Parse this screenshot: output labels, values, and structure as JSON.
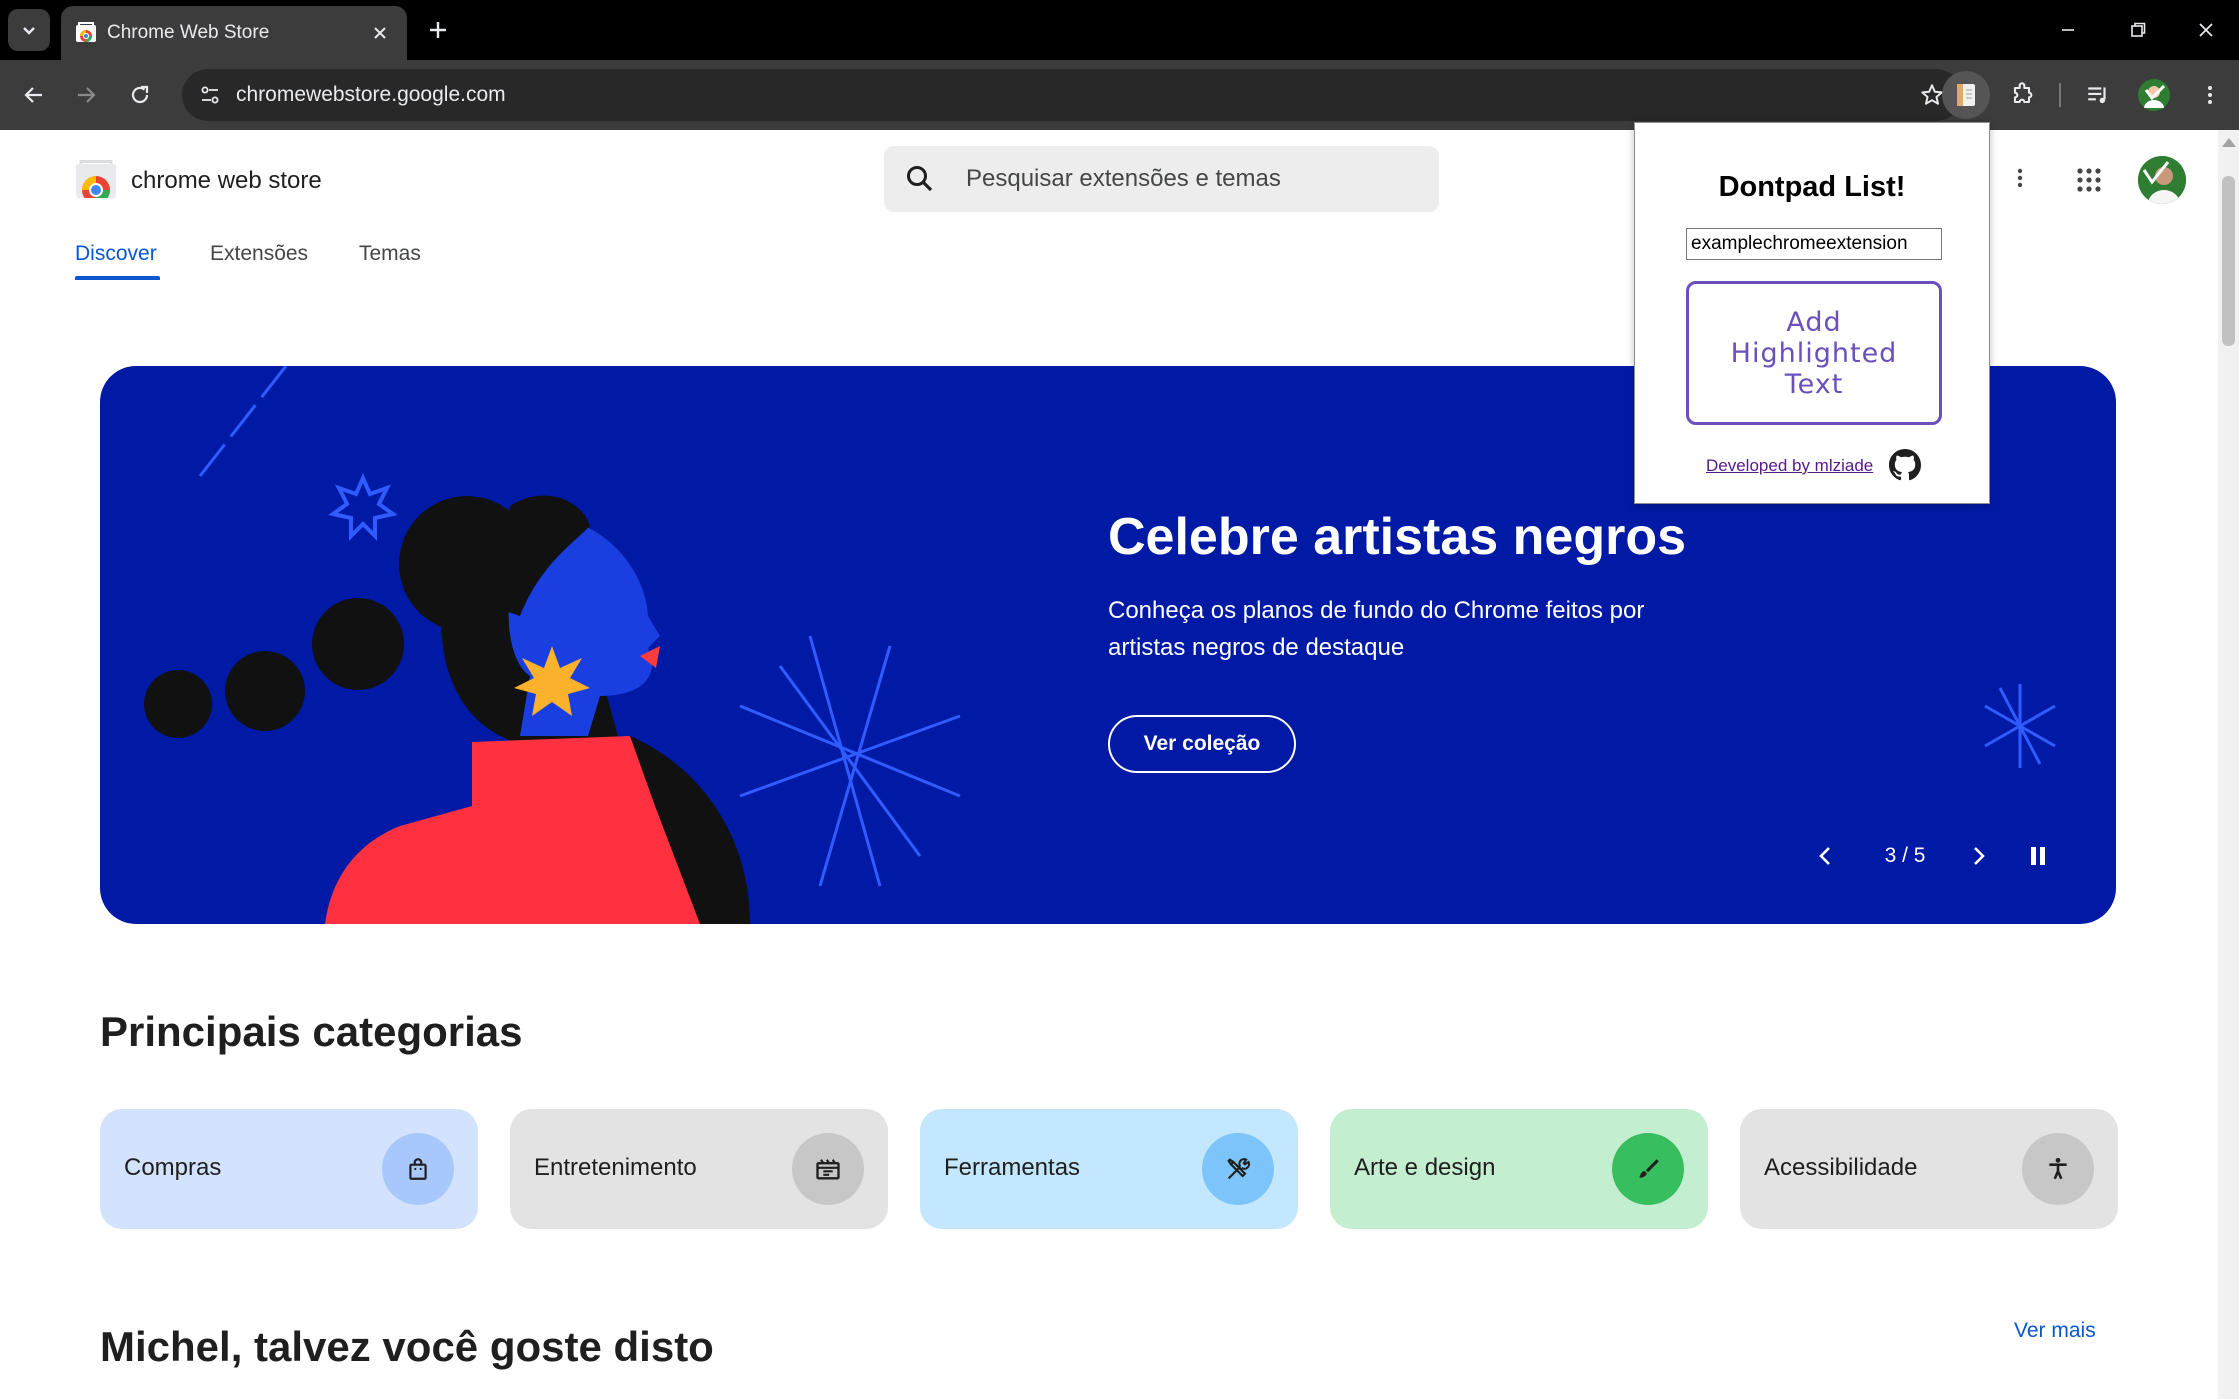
{
  "browser": {
    "tab_title": "Chrome Web Store",
    "url": "chromewebstore.google.com"
  },
  "store": {
    "brand": "chrome web store",
    "search_placeholder": "Pesquisar extensões e temas",
    "nav_tabs": [
      {
        "label": "Discover",
        "active": true
      },
      {
        "label": "Extensões",
        "active": false
      },
      {
        "label": "Temas",
        "active": false
      }
    ]
  },
  "hero": {
    "title": "Celebre artistas negros",
    "subtitle": "Conheça os planos de fundo do Chrome feitos por artistas negros de destaque",
    "button": "Ver coleção",
    "counter": "3 / 5"
  },
  "categories": {
    "title": "Principais categorias",
    "items": [
      {
        "label": "Compras",
        "icon": "shopping-bag-icon",
        "bg": "#d3e3fd",
        "icon_bg": "#a8c7fa"
      },
      {
        "label": "Entretenimento",
        "icon": "movie-icon",
        "bg": "#e3e3e3",
        "icon_bg": "#c7c7c7"
      },
      {
        "label": "Ferramentas",
        "icon": "tools-icon",
        "bg": "#c2e7ff",
        "icon_bg": "#7cc4fa"
      },
      {
        "label": "Arte e design",
        "icon": "brush-icon",
        "bg": "#c4eed0",
        "icon_bg": "#37be5f"
      },
      {
        "label": "Acessibilidade",
        "icon": "accessibility-icon",
        "bg": "#e3e3e3",
        "icon_bg": "#c7c7c7"
      }
    ]
  },
  "recommend": {
    "title": "Michel, talvez você goste disto",
    "more": "Ver mais"
  },
  "popup": {
    "title": "Dontpad List!",
    "input_value": "examplechromeextension",
    "button": "Add Highlighted Text",
    "link": "Developed by mlziade"
  },
  "colors": {
    "hero_bg": "#001aa6",
    "accent": "#0b57d0",
    "popup_accent": "#6b4fbb"
  }
}
